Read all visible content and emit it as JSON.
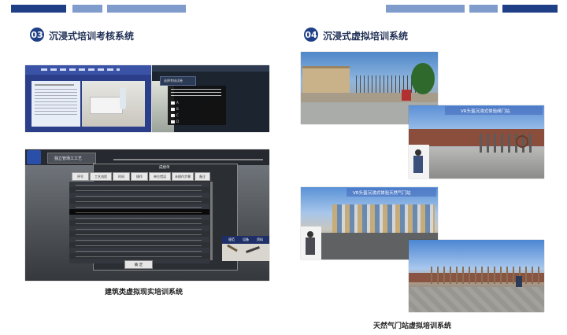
{
  "sections": [
    {
      "number": "03",
      "title": "沉浸式培训考核系统"
    },
    {
      "number": "04",
      "title": "沉浸式虚拟培训系统"
    }
  ],
  "captions": {
    "left": "建筑类虚拟现实培训系统",
    "right": "天然气门站虚拟培训系统"
  },
  "screens": {
    "exam_window_title": "选择考核试卷",
    "exam_options": [
      "A",
      "B",
      "C",
      "D"
    ],
    "module_title": "独立管场工工艺",
    "score_title": "成绩单",
    "score_headers": [
      "序号",
      "工艺流程",
      "时间",
      "操作",
      "单位错误",
      "未操作步骤",
      "备注"
    ],
    "score_button": "确 定",
    "sidebar_tabs": [
      "规范",
      "设备",
      "资料"
    ],
    "vr_banner_top": "VR头盔沉浸式体验阀门站",
    "vr_banner_bottom": "VR头盔沉浸式体验天然气门站"
  },
  "colors": {
    "accent_dark": "#1f3f86",
    "accent_light": "#7f9ccd"
  }
}
